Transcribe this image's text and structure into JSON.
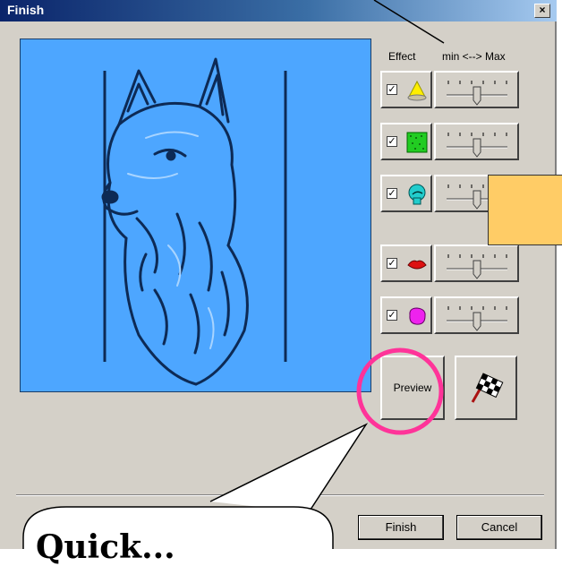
{
  "window": {
    "title": "Finish",
    "close_label": "×"
  },
  "columns": {
    "effect_label": "Effect",
    "range_label": "min <--> Max"
  },
  "effects": [
    {
      "icon": "cone-light-icon",
      "checked": true,
      "level": 0.5
    },
    {
      "icon": "green-texture-icon",
      "checked": true,
      "level": 0.5
    },
    {
      "icon": "cyan-head-icon",
      "checked": true,
      "level": 0.5
    },
    {
      "icon": "red-lips-icon",
      "checked": true,
      "level": 0.5
    },
    {
      "icon": "magenta-blob-icon",
      "checked": true,
      "level": 0.5
    }
  ],
  "preview_button": {
    "label": "Preview"
  },
  "buttons": {
    "finish": "Finish",
    "cancel": "Cancel"
  },
  "callout": {
    "text": "Quick..."
  },
  "colors": {
    "preview_bg": "#4da6ff",
    "highlight_circle": "#ff3399",
    "note_fill": "#ffcc66",
    "titlebar": "#0a246a"
  }
}
